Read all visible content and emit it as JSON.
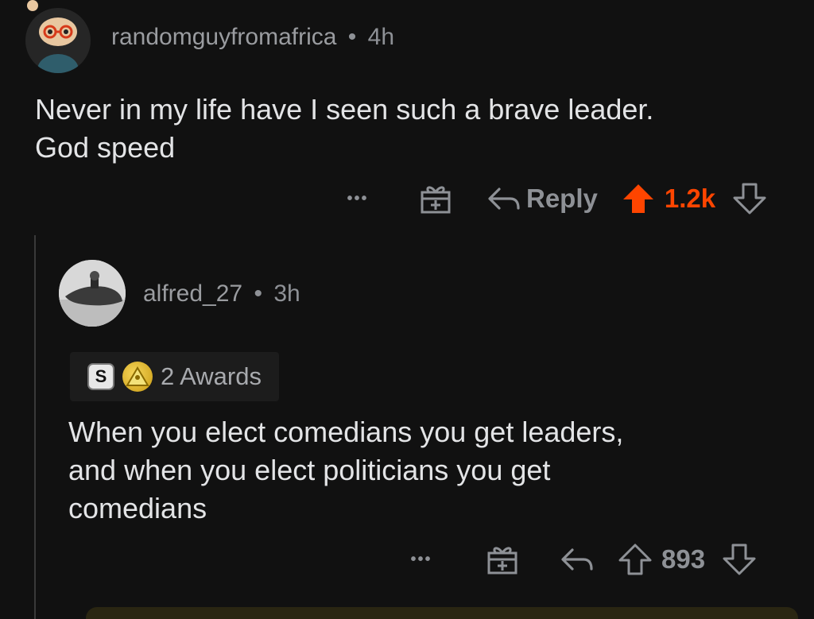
{
  "top_comment": {
    "username": "randomguyfromafrica",
    "separator": "•",
    "time": "4h",
    "body_line1": "Never in my life have I seen such a brave leader.",
    "body_line2": "God speed",
    "actions": {
      "more": "•••",
      "reply_label": "Reply",
      "score": "1.2k",
      "upvoted": true
    }
  },
  "reply_comment": {
    "username": "alfred_27",
    "separator": "•",
    "time": "3h",
    "awards": {
      "silver_letter": "S",
      "label": "2 Awards"
    },
    "body_line1": "When you elect comedians you get leaders,",
    "body_line2": "and when you elect politicians you get",
    "body_line3": "comedians",
    "actions": {
      "more": "•••",
      "score": "893",
      "upvoted": false
    }
  },
  "colors": {
    "background": "#111111",
    "upvote_active": "#ff4500",
    "muted": "#8e9196"
  }
}
